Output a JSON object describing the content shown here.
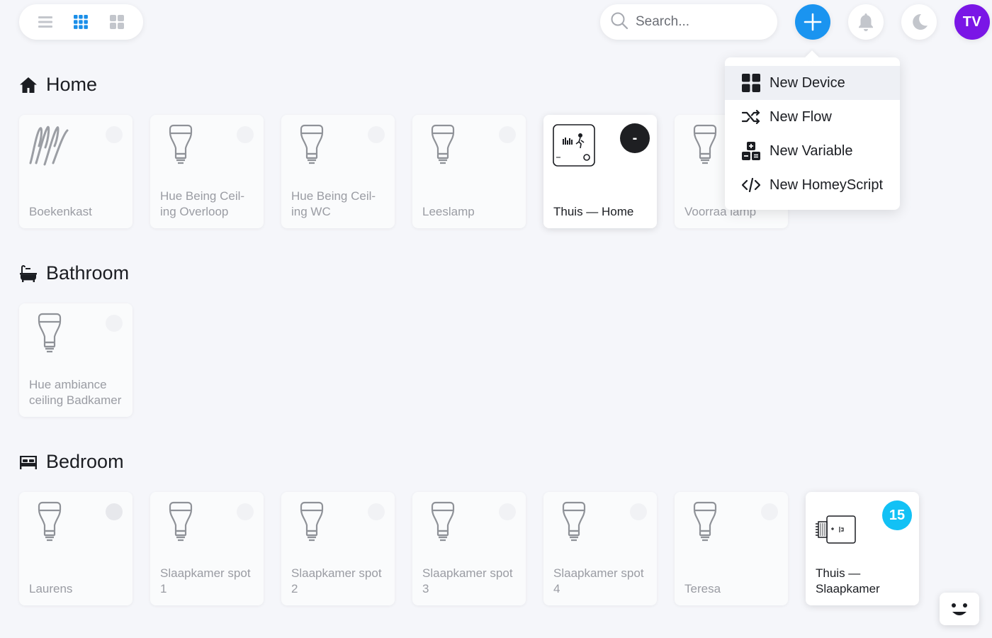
{
  "topbar": {
    "search_placeholder": "Search...",
    "avatar_initials": "TV",
    "accent_color": "#1a94f0",
    "avatar_color": "#7a16e6"
  },
  "add_menu": {
    "items": [
      {
        "label": "New Device",
        "icon": "device-grid-icon"
      },
      {
        "label": "New Flow",
        "icon": "shuffle-icon"
      },
      {
        "label": "New Variable",
        "icon": "variable-icon"
      },
      {
        "label": "New HomeyScript",
        "icon": "code-icon"
      }
    ]
  },
  "sections": [
    {
      "title": "Home",
      "icon": "house-icon",
      "devices": [
        {
          "name": "Boekenkast",
          "icon": "light-strip-icon"
        },
        {
          "name": "Hue Being Ceil- ing Overloop",
          "icon": "bulb-icon"
        },
        {
          "name": "Hue Being Ceil- ing WC",
          "icon": "bulb-icon"
        },
        {
          "name": "Leeslamp",
          "icon": "bulb-icon"
        },
        {
          "name": "Thuis — Home",
          "icon": "thermostat-icon",
          "badge": "-"
        },
        {
          "name": "Voorraa lamp",
          "icon": "bulb-icon"
        }
      ]
    },
    {
      "title": "Bathroom",
      "icon": "bathtub-icon",
      "devices": [
        {
          "name": "Hue ambiance ceiling Badkamer",
          "icon": "bulb-icon"
        }
      ]
    },
    {
      "title": "Bedroom",
      "icon": "bed-icon",
      "devices": [
        {
          "name": "Laurens",
          "icon": "bulb-icon"
        },
        {
          "name": "Slaapkamer spot 1",
          "icon": "bulb-icon"
        },
        {
          "name": "Slaapkamer spot 2",
          "icon": "bulb-icon"
        },
        {
          "name": "Slaapkamer spot 3",
          "icon": "bulb-icon"
        },
        {
          "name": "Slaapkamer spot 4",
          "icon": "bulb-icon"
        },
        {
          "name": "Teresa",
          "icon": "bulb-icon"
        },
        {
          "name": "Thuis — Slaapkamer",
          "icon": "radiator-valve-icon",
          "badge": "15"
        }
      ]
    }
  ]
}
